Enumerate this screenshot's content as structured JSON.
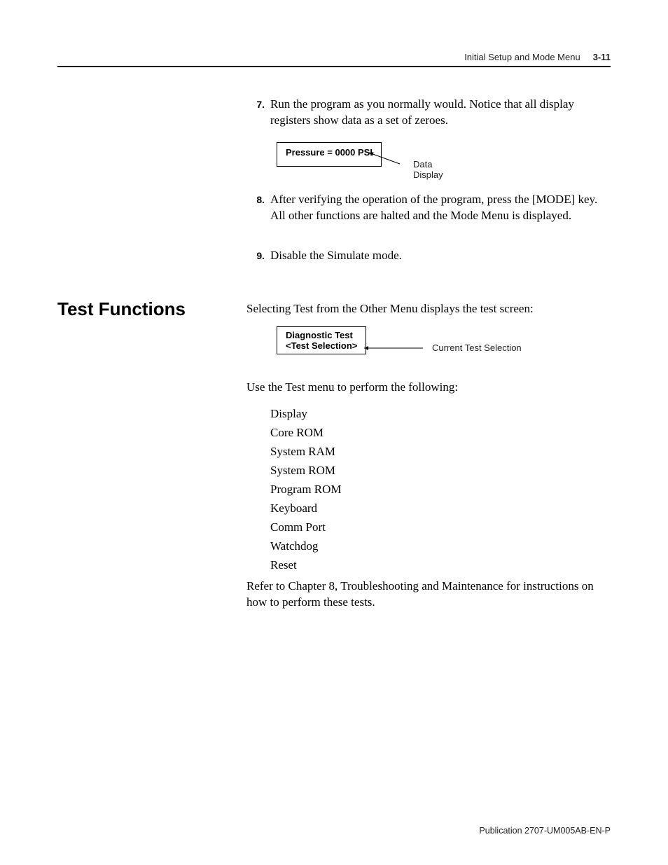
{
  "header": {
    "title": "Initial Setup and Mode Menu",
    "page_number": "3-11"
  },
  "steps": {
    "s7": {
      "num": "7.",
      "text": "Run the program as you normally would. Notice that all display registers show data as a set of zeroes.",
      "box_text": "Pressure = 0000 PSI",
      "callout": "Data Display"
    },
    "s8": {
      "num": "8.",
      "text": "After verifying the operation of the program, press the [MODE] key. All other functions are halted and the Mode Menu is displayed."
    },
    "s9": {
      "num": "9.",
      "text": "Disable the Simulate mode."
    }
  },
  "section": {
    "heading": "Test Functions",
    "intro": "Selecting Test from the Other Menu displays the test screen:",
    "box_line1": "Diagnostic Test",
    "box_line2": "<Test Selection>",
    "box_callout": "Current Test Selection",
    "use_text": "Use the Test menu to perform the following:",
    "items": [
      "Display",
      "Core ROM",
      "System RAM",
      "System ROM",
      "Program ROM",
      "Keyboard",
      "Comm Port",
      "Watchdog",
      "Reset"
    ],
    "refer": "Refer to Chapter 8, Troubleshooting and Maintenance for instructions on how to perform these tests."
  },
  "footer": "Publication 2707-UM005AB-EN-P"
}
